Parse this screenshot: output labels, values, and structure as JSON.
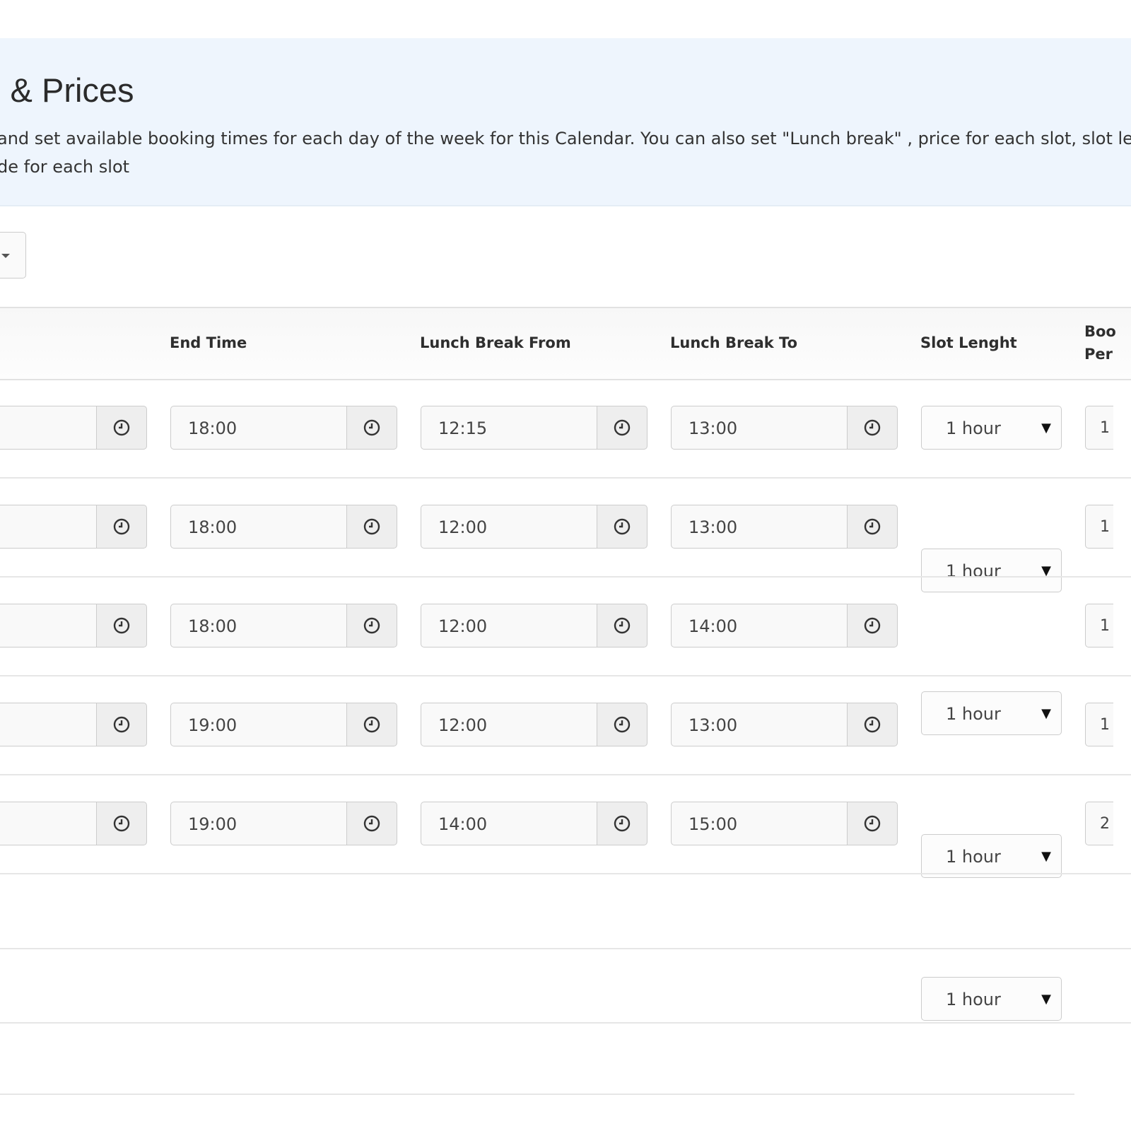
{
  "header": {
    "title": "s & Prices",
    "description_line1": "and set available booking times for each day of the week for this Calendar. You can also set \"Lunch break\" , price for each slot, slot leng",
    "description_line2": "de for each slot"
  },
  "columns": {
    "end_time": "End Time",
    "lunch_from": "Lunch Break From",
    "lunch_to": "Lunch Break To",
    "slot_length": "Slot Lenght",
    "bookings_line1": "Boo",
    "bookings_line2": "Per"
  },
  "rows": [
    {
      "end_time": "18:00",
      "lunch_from": "12:15",
      "lunch_to": "13:00",
      "slot_length": "1 hour",
      "bookings": "1"
    },
    {
      "end_time": "18:00",
      "lunch_from": "12:00",
      "lunch_to": "13:00",
      "slot_length": "1 hour",
      "bookings": "1"
    },
    {
      "end_time": "18:00",
      "lunch_from": "12:00",
      "lunch_to": "14:00",
      "slot_length": "1 hour",
      "bookings": "1"
    },
    {
      "end_time": "19:00",
      "lunch_from": "12:00",
      "lunch_to": "13:00",
      "slot_length": "1 hour",
      "bookings": "1"
    },
    {
      "end_time": "19:00",
      "lunch_from": "14:00",
      "lunch_to": "15:00",
      "slot_length": "1 hour",
      "bookings": "2"
    }
  ],
  "colors": {
    "panel_bg": "#eef5fd",
    "addon_bg": "#eeeeee",
    "border": "#cccccc"
  },
  "icons": {
    "time_addon": "clock-icon",
    "select_arrow": "caret-down-icon"
  }
}
